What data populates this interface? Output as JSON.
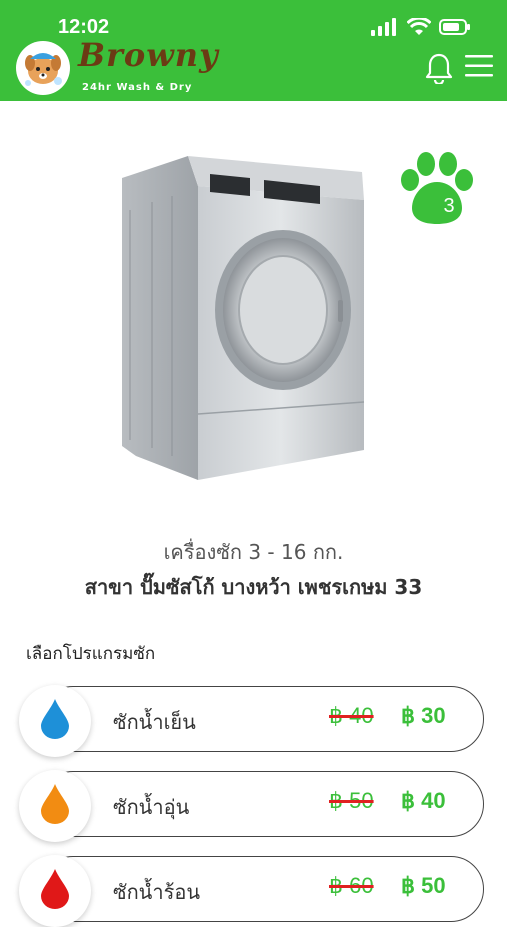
{
  "status": {
    "time": "12:02"
  },
  "header": {
    "brand": "Browny",
    "tagline": "24hr Wash & Dry"
  },
  "machine": {
    "number": "3",
    "title": "เครื่องซัก 3 - 16 กก.",
    "branch": "สาขา ปั๊มซัสโก้ บางหว้า เพชรเกษม 33"
  },
  "programs_label": "เลือกโปรแกรมซัก",
  "programs": [
    {
      "name": "ซักน้ำเย็น",
      "old_price": "฿ 40",
      "new_price": "฿ 30",
      "color": "#1e90d8"
    },
    {
      "name": "ซักน้ำอุ่น",
      "old_price": "฿ 50",
      "new_price": "฿ 40",
      "color": "#f28c12"
    },
    {
      "name": "ซักน้ำร้อน",
      "old_price": "฿ 60",
      "new_price": "฿ 50",
      "color": "#e01818"
    }
  ],
  "colors": {
    "brand_green": "#3bbf3a",
    "brand_brown": "#6b3b14",
    "strike_red": "#e02020"
  }
}
